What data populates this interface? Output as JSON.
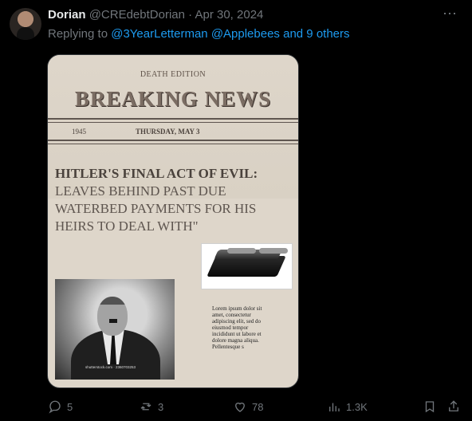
{
  "post": {
    "author_name": "Dorian",
    "handle": "@CREdebtDorian",
    "separator": "·",
    "date": "Apr 30, 2024",
    "reply_prefix": "Replying to",
    "reply_user_1": "@3YearLetterman",
    "reply_user_2": "@Applebees",
    "reply_suffix": "and 9 others",
    "more_icon": "more-horizontal-icon"
  },
  "newspaper": {
    "edition": "DEATH EDITION",
    "title": "BREAKING NEWS",
    "year": "1945",
    "date": "THURSDAY, MAY 3",
    "headline_lead": "HITLER'S FINAL ACT OF EVIL:",
    "headline_body": "LEAVES BEHIND PAST DUE WATERBED PAYMENTS FOR HIS HEIRS TO DEAL WITH\"",
    "portrait_watermark": "shutterstock.com · 2360703253",
    "lorem_text": "Lorem ipsum dolor sit amet, consectetur adipiscing elit, sed do eiusmod tempor incididunt ut labore et dolore magna aliqua. Pellentesque s"
  },
  "actions": {
    "replies": "5",
    "reposts": "3",
    "likes": "78",
    "views": "1.3K"
  },
  "colors": {
    "background": "#000000",
    "muted_text": "#71767b",
    "link": "#1d9bf0",
    "paper": "#ded6ca"
  }
}
